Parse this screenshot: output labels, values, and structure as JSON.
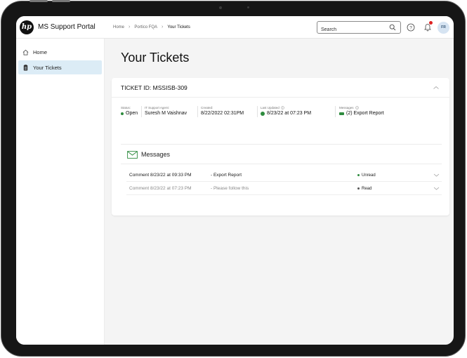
{
  "app": {
    "title": "MS Support Portal",
    "logo_text": "hp"
  },
  "breadcrumb": [
    "Home",
    "Portico FQA",
    "Your Tickets"
  ],
  "search": {
    "placeholder": "Search",
    "value": ""
  },
  "user": {
    "initials": "FR"
  },
  "sidebar": {
    "items": [
      {
        "label": "Home",
        "icon": "home-icon",
        "active": false
      },
      {
        "label": "Your Tickets",
        "icon": "ticket-icon",
        "active": true
      }
    ]
  },
  "page": {
    "title": "Your Tickets"
  },
  "ticket": {
    "id_text": "TICKET ID: MSSISB-309",
    "status_label": "Status:",
    "status_value": "Open",
    "agent_label": "IT Support Agent:",
    "agent_value": "Suresh M Vaishnav",
    "created_label": "Created:",
    "created_value": "8/22/2022 02:31PM",
    "updated_label": "Last Updated",
    "updated_value": "8/23/22 at 07:23 PM",
    "messages_label": "Messages",
    "messages_value": "(2) Export Report"
  },
  "messages": {
    "title": "Messages",
    "rows": [
      {
        "comment": "Comment 8/23/22 at 09:33 PM",
        "subject": "- Export Report",
        "status": "Unread"
      },
      {
        "comment": "Comment 8/23/22 at 07:23 PM",
        "subject": "- Please follow this",
        "status": "Read"
      }
    ]
  },
  "colors": {
    "accent_active": "#dcecf6",
    "status_green": "#2e8b3e",
    "notification_red": "#dd2222"
  }
}
